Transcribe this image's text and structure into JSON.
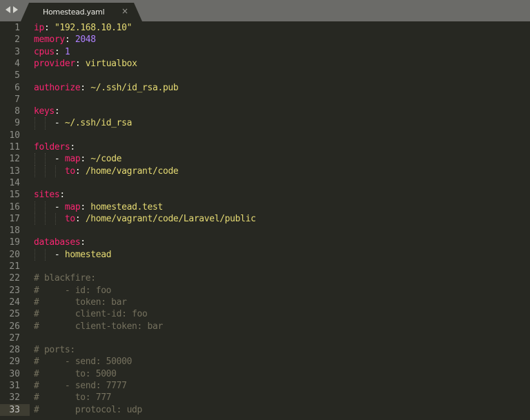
{
  "window": {
    "tab": {
      "title": "Homestead.yaml",
      "close": "×"
    },
    "nav": {
      "back": "◀",
      "forward": "▶"
    }
  },
  "theme": {
    "keyword": "#f92672",
    "string": "#e6db74",
    "number": "#ae81ff",
    "comment": "#75715e",
    "background": "#272822"
  },
  "editor": {
    "active_line": 33,
    "lines": [
      {
        "n": "1",
        "tokens": [
          [
            "k",
            "ip"
          ],
          [
            "p",
            ": "
          ],
          [
            "s",
            "\"192.168.10.10\""
          ]
        ]
      },
      {
        "n": "2",
        "tokens": [
          [
            "k",
            "memory"
          ],
          [
            "p",
            ": "
          ],
          [
            "n",
            "2048"
          ]
        ]
      },
      {
        "n": "3",
        "tokens": [
          [
            "k",
            "cpus"
          ],
          [
            "p",
            ": "
          ],
          [
            "n",
            "1"
          ]
        ]
      },
      {
        "n": "4",
        "tokens": [
          [
            "k",
            "provider"
          ],
          [
            "p",
            ": "
          ],
          [
            "s",
            "virtualbox"
          ]
        ]
      },
      {
        "n": "5",
        "tokens": []
      },
      {
        "n": "6",
        "tokens": [
          [
            "k",
            "authorize"
          ],
          [
            "p",
            ": "
          ],
          [
            "s",
            "~/.ssh/id_rsa.pub"
          ]
        ]
      },
      {
        "n": "7",
        "tokens": []
      },
      {
        "n": "8",
        "tokens": [
          [
            "k",
            "keys"
          ],
          [
            "p",
            ":"
          ]
        ]
      },
      {
        "n": "9",
        "guides": 2,
        "tokens": [
          [
            "p",
            "    - "
          ],
          [
            "s",
            "~/.ssh/id_rsa"
          ]
        ]
      },
      {
        "n": "10",
        "tokens": []
      },
      {
        "n": "11",
        "tokens": [
          [
            "k",
            "folders"
          ],
          [
            "p",
            ":"
          ]
        ]
      },
      {
        "n": "12",
        "guides": 2,
        "tokens": [
          [
            "p",
            "    - "
          ],
          [
            "k",
            "map"
          ],
          [
            "p",
            ": "
          ],
          [
            "s",
            "~/code"
          ]
        ]
      },
      {
        "n": "13",
        "guides": 3,
        "tokens": [
          [
            "p",
            "      "
          ],
          [
            "k",
            "to"
          ],
          [
            "p",
            ": "
          ],
          [
            "s",
            "/home/vagrant/code"
          ]
        ]
      },
      {
        "n": "14",
        "tokens": []
      },
      {
        "n": "15",
        "tokens": [
          [
            "k",
            "sites"
          ],
          [
            "p",
            ":"
          ]
        ]
      },
      {
        "n": "16",
        "guides": 2,
        "tokens": [
          [
            "p",
            "    - "
          ],
          [
            "k",
            "map"
          ],
          [
            "p",
            ": "
          ],
          [
            "s",
            "homestead.test"
          ]
        ]
      },
      {
        "n": "17",
        "guides": 3,
        "tokens": [
          [
            "p",
            "      "
          ],
          [
            "k",
            "to"
          ],
          [
            "p",
            ": "
          ],
          [
            "s",
            "/home/vagrant/code/Laravel/public"
          ]
        ]
      },
      {
        "n": "18",
        "tokens": []
      },
      {
        "n": "19",
        "tokens": [
          [
            "k",
            "databases"
          ],
          [
            "p",
            ":"
          ]
        ]
      },
      {
        "n": "20",
        "guides": 2,
        "tokens": [
          [
            "p",
            "    - "
          ],
          [
            "s",
            "homestead"
          ]
        ]
      },
      {
        "n": "21",
        "tokens": []
      },
      {
        "n": "22",
        "tokens": [
          [
            "c",
            "# blackfire:"
          ]
        ]
      },
      {
        "n": "23",
        "tokens": [
          [
            "c",
            "#     - id: foo"
          ]
        ]
      },
      {
        "n": "24",
        "tokens": [
          [
            "c",
            "#       token: bar"
          ]
        ]
      },
      {
        "n": "25",
        "tokens": [
          [
            "c",
            "#       client-id: foo"
          ]
        ]
      },
      {
        "n": "26",
        "tokens": [
          [
            "c",
            "#       client-token: bar"
          ]
        ]
      },
      {
        "n": "27",
        "tokens": []
      },
      {
        "n": "28",
        "tokens": [
          [
            "c",
            "# ports:"
          ]
        ]
      },
      {
        "n": "29",
        "tokens": [
          [
            "c",
            "#     - send: 50000"
          ]
        ]
      },
      {
        "n": "30",
        "tokens": [
          [
            "c",
            "#       to: 5000"
          ]
        ]
      },
      {
        "n": "31",
        "tokens": [
          [
            "c",
            "#     - send: 7777"
          ]
        ]
      },
      {
        "n": "32",
        "tokens": [
          [
            "c",
            "#       to: 777"
          ]
        ]
      },
      {
        "n": "33",
        "tokens": [
          [
            "c",
            "#       protocol: udp"
          ]
        ]
      }
    ]
  }
}
